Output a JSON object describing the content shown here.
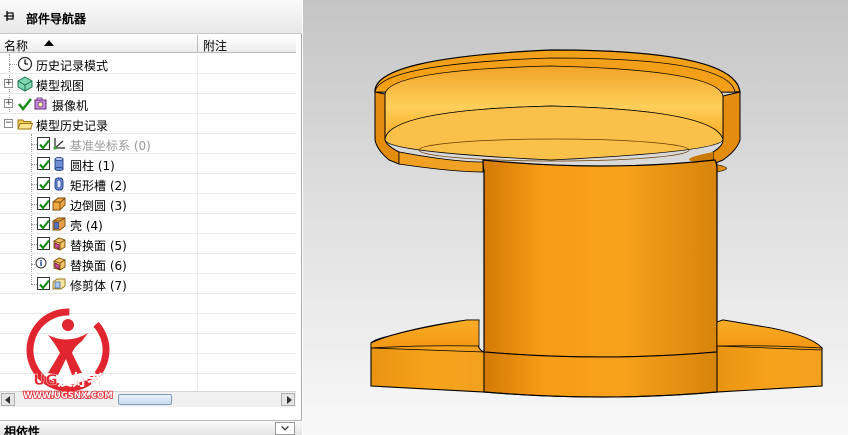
{
  "navigator": {
    "title": "部件导航器",
    "columns": {
      "name": "名称",
      "note": "附注"
    },
    "items": [
      {
        "label": "历史记录模式",
        "icon": "clock-icon"
      },
      {
        "label": "模型视图",
        "icon": "model-view-icon",
        "expander": "+"
      },
      {
        "label": "摄像机",
        "icon": "camera-icon",
        "expander": "+",
        "checkmark": true
      },
      {
        "label": "模型历史记录",
        "icon": "folder-open-icon",
        "expander": "−"
      },
      {
        "label": "基准坐标系 (0)",
        "icon": "datum-csys-icon",
        "checked": true,
        "dimmed": true
      },
      {
        "label": "圆柱 (1)",
        "icon": "cylinder-icon",
        "checked": true
      },
      {
        "label": "矩形槽 (2)",
        "icon": "slot-icon",
        "checked": true
      },
      {
        "label": "边倒圆 (3)",
        "icon": "edge-blend-icon",
        "checked": true
      },
      {
        "label": "壳 (4)",
        "icon": "shell-icon",
        "checked": true
      },
      {
        "label": "替换面 (5)",
        "icon": "replace-face-icon",
        "checked": true
      },
      {
        "label": "替换面 (6)",
        "icon": "replace-face-icon",
        "checked": false,
        "info": true
      },
      {
        "label": "修剪体 (7)",
        "icon": "trim-body-icon",
        "checked": true
      }
    ]
  },
  "dependencies": {
    "title": "相依性"
  },
  "watermark": {
    "brand": "UG爱好者",
    "url": "WWW.UGSNX.COM"
  },
  "colors": {
    "part_orange": "#f7a21b",
    "part_dark": "#c46f08",
    "part_light": "#ffd25c",
    "check_green": "#1a8c1a",
    "logo_red": "#e0141e"
  }
}
